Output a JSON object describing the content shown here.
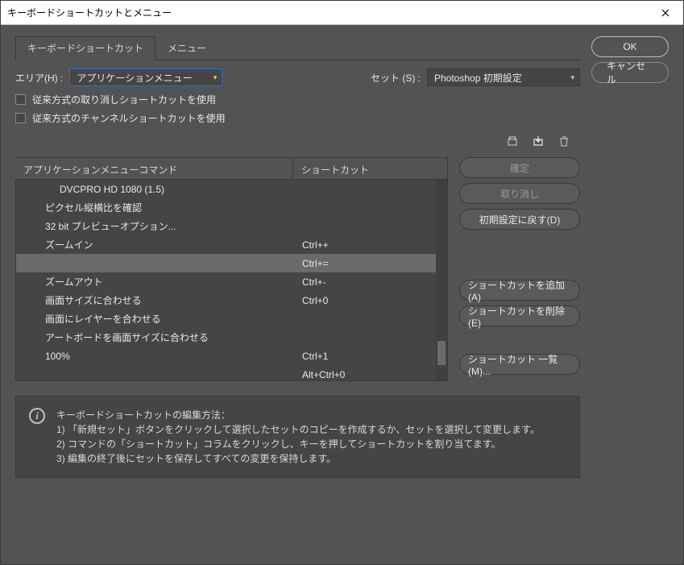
{
  "title": "キーボードショートカットとメニュー",
  "tabs": {
    "shortcuts": "キーボードショートカット",
    "menus": "メニュー"
  },
  "area": {
    "label": "エリア(H) :",
    "value": "アプリケーションメニュー"
  },
  "set": {
    "label": "セット (S) :",
    "value": "Photoshop 初期設定"
  },
  "legacyUndo": "従来方式の取り消しショートカットを使用",
  "legacyChannel": "従来方式のチャンネルショートカットを使用",
  "headers": {
    "command": "アプリケーションメニューコマンド",
    "shortcut": "ショートカット"
  },
  "rows": [
    {
      "cmd": "DVCPRO HD 1080 (1.5)",
      "sc": "",
      "deep": true
    },
    {
      "cmd": "ピクセル縦横比を確認",
      "sc": ""
    },
    {
      "cmd": "32 bit プレビューオプション...",
      "sc": ""
    },
    {
      "cmd": "ズームイン",
      "sc": "Ctrl++"
    },
    {
      "cmd": "",
      "sc": "Ctrl+=",
      "sel": true
    },
    {
      "cmd": "ズームアウト",
      "sc": "Ctrl+-"
    },
    {
      "cmd": "画面サイズに合わせる",
      "sc": "Ctrl+0"
    },
    {
      "cmd": "画面にレイヤーを合わせる",
      "sc": ""
    },
    {
      "cmd": "アートボードを画面サイズに合わせる",
      "sc": ""
    },
    {
      "cmd": "100%",
      "sc": "Ctrl+1"
    },
    {
      "cmd": "",
      "sc": "Alt+Ctrl+0"
    }
  ],
  "buttons": {
    "confirm": "確定",
    "undo": "取り消し",
    "reset": "初期設定に戻す(D)",
    "add": "ショートカットを追加(A)",
    "delete": "ショートカットを削除(E)",
    "summary": "ショートカット 一覧(M)...",
    "ok": "OK",
    "cancel": "キャンセル"
  },
  "help": {
    "title": "キーボードショートカットの編集方法：",
    "l1": "1) 「新規セット」ボタンをクリックして選択したセットのコピーを作成するか、セットを選択して変更します。",
    "l2": "2) コマンドの「ショートカット」コラムをクリックし、キーを押してショートカットを割り当てます。",
    "l3": "3) 編集の終了後にセットを保存してすべての変更を保持します。"
  }
}
